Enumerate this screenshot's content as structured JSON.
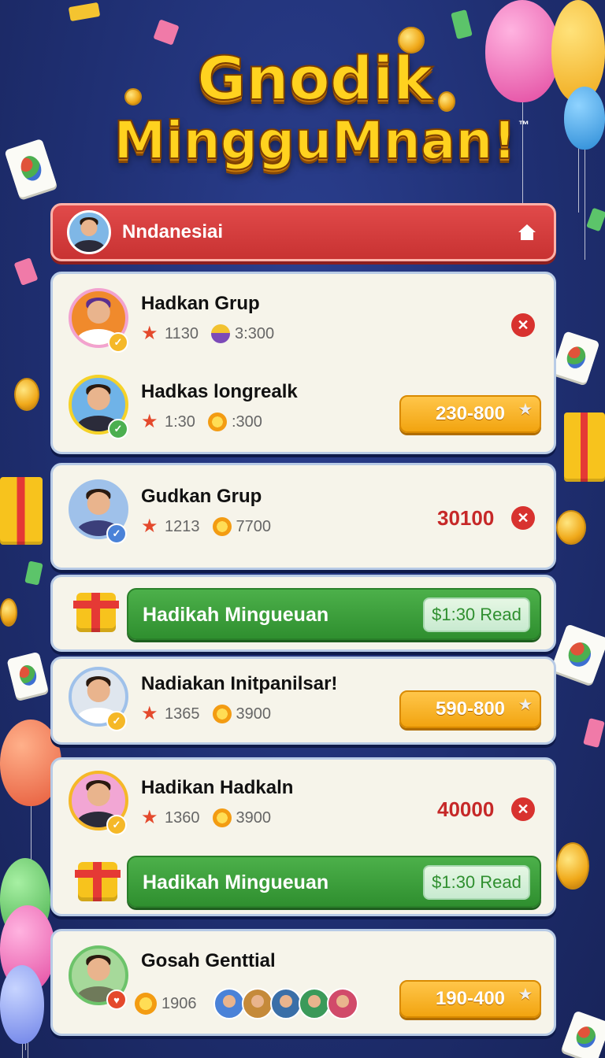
{
  "title": {
    "line1": "Gnodik",
    "line2": "MingguMnan!",
    "tm": "™"
  },
  "header": {
    "name": "Nndanesiai",
    "home_icon": "home-icon"
  },
  "cards": [
    {
      "rows": [
        {
          "name": "Hadkan Grup",
          "stat1": "1130",
          "stat2": "3:300",
          "action": "close",
          "avatar_bg": "#f08a2c"
        },
        {
          "name": "Hadkas longrealk",
          "stat1": "1:30",
          "stat2": ":300",
          "pill": "230-800",
          "avatar_bg": "#6fb3e8"
        }
      ]
    },
    {
      "rows": [
        {
          "name": "Gudkan Grup",
          "stat1": "1213",
          "stat2": "7700",
          "score": "30100",
          "action": "close",
          "avatar_bg": "#9fc1ea"
        }
      ]
    },
    {
      "gift_bar": {
        "label": "Hadikah Mingueuan",
        "button": "$1:30 Read"
      }
    },
    {
      "rows": [
        {
          "name": "Nadiakan Initpanilsar!",
          "stat1": "1365",
          "stat2": "3900",
          "pill": "590-800",
          "avatar_bg": "#dfe6ee"
        }
      ]
    },
    {
      "rows": [
        {
          "name": "Hadikan Hadkaln",
          "stat1": "1360",
          "stat2": "3900",
          "score": "40000",
          "action": "close",
          "avatar_bg": "#f2a6d4"
        }
      ],
      "gift_bar": {
        "label": "Hadikah Mingueuan",
        "button": "$1:30 Read"
      }
    },
    {
      "rows": [
        {
          "name": "Gosah Genttial",
          "stat1": "1906",
          "pill": "190-400",
          "avatar_bg": "#a6d99a"
        }
      ]
    }
  ],
  "colors": {
    "background": "#1f2f72",
    "header_red": "#d83a3a",
    "card_bg": "#f6f4ea",
    "title_gold": "#ffd21f",
    "pill_orange": "#f7b52a",
    "green": "#3aa03a"
  }
}
